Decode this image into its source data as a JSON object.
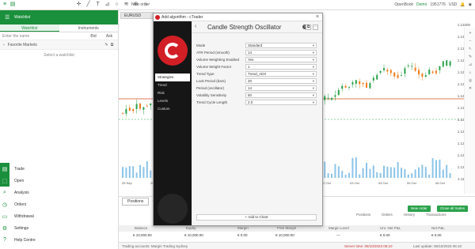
{
  "topbar": {
    "center_text": "New order",
    "platform": "OpenBook",
    "account": "Demo",
    "account_id": "1951776",
    "currency": "USD"
  },
  "sidebar": {
    "header_title": "Watchlist",
    "tabs": [
      "Watchlist",
      "Instruments"
    ],
    "search_placeholder": "Enter the name",
    "search_col1": "Bid",
    "search_col2": "Ask",
    "favorites_label": "Favorite Markets",
    "empty_message": "Select a watchlist",
    "nav": [
      {
        "label": "Trade",
        "icon": "trade-icon"
      },
      {
        "label": "Open",
        "icon": "open-icon"
      },
      {
        "label": "Analysis",
        "icon": "analysis-icon"
      },
      {
        "label": "Orders",
        "icon": "orders-icon"
      },
      {
        "label": "Withdrawal",
        "icon": "withdrawal-icon"
      },
      {
        "label": "Settings",
        "icon": "settings-icon"
      },
      {
        "label": "Help Centre",
        "icon": "help-icon"
      }
    ]
  },
  "chart": {
    "tab_label": "EURUSD",
    "y_ticks": [
      "1.13200",
      "1.13100",
      "1.13000",
      "1.12900",
      "1.12800",
      "1.12700",
      "1.12600",
      "1.12500",
      "1.12400",
      "1.12300",
      "1.12200",
      "1.12100",
      "1.12000",
      "1.11900"
    ],
    "x_ticks": [
      "25 Sep",
      "26 Sep",
      "27 Sep",
      "28 Sep",
      "29 Sep",
      "30 Sep",
      "01 Oct",
      "02 Oct",
      "03 Oct",
      "04 Oct",
      "05 Oct",
      "06 Oct"
    ]
  },
  "modal": {
    "window_title": "Add algorithm - cTrader",
    "heading": "Candle Strength Oscillator",
    "menu": [
      "Strategies",
      "Trend",
      "Risk",
      "Levels",
      "Custom"
    ],
    "params": [
      {
        "label": "Mode",
        "value": "Standard"
      },
      {
        "label": "ATR Period (smooth)",
        "value": "14"
      },
      {
        "label": "Volume Weighting Enabled",
        "value": "Yes"
      },
      {
        "label": "Volume Weight Factor",
        "value": "1"
      },
      {
        "label": "Trend Type",
        "value": "Trend_ADX"
      },
      {
        "label": "Look Period (bars)",
        "value": "20"
      },
      {
        "label": "Period (oscillator)",
        "value": "14"
      },
      {
        "label": "Volatility Sensitivity",
        "value": "50"
      },
      {
        "label": "Trend Cycle Length",
        "value": "2.0"
      }
    ],
    "add_button": "+ Add to Chart"
  },
  "bottom": {
    "tab_label": "Positions",
    "new_order": "New order",
    "close_all": "Close all trades",
    "filter": [
      "Positions",
      "Orders",
      "History",
      "Transactions"
    ],
    "columns": [
      "Balance",
      "Equity",
      "Margin",
      "Free Margin",
      "Margin Level",
      "Unr. Net P&L",
      "Net P&L"
    ],
    "values": [
      "€ 10,000.00",
      "€ 10,000.00",
      "€ 0.00",
      "€ 10,000.00",
      "—",
      "€ 0.00",
      "€ 0.00"
    ],
    "status_left": "Trading accounts: Margin Trading Sydney",
    "status_right_1": "Server time: 06/10/2023 06:10",
    "status_right_2": "Last update: 06/10/2023 06:10"
  },
  "colors": {
    "accent": "#1a8f3c",
    "up": "#2aa24b",
    "down": "#ef7d1b",
    "logo": "#d21f26"
  }
}
